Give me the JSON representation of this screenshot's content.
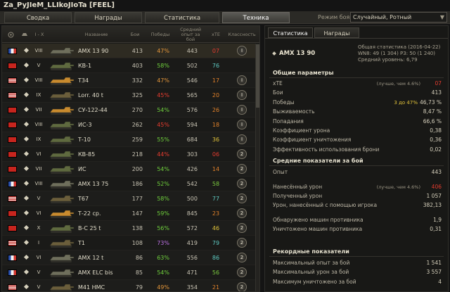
{
  "window": {
    "title": "Za_PyJIeM_LLIkoJIoTa [FEEL]"
  },
  "tabs": [
    {
      "label": "Сводка",
      "active": false
    },
    {
      "label": "Награды",
      "active": false
    },
    {
      "label": "Статистика",
      "active": false
    },
    {
      "label": "Техника",
      "active": true
    }
  ],
  "mode": {
    "label": "Режим боя:",
    "value": "Случайный, Ротный"
  },
  "table_header": {
    "type": "I - X",
    "name": "Название",
    "battles": "Бои",
    "wins": "Победы",
    "avg_xp": "Средний опыт за бой",
    "xte": "хТЕ",
    "mastery": "Классность"
  },
  "colors": {
    "wr_purple": "#b96fe0",
    "wr_green": "#6fcf3c",
    "wr_orange": "#e2953a",
    "wr_red": "#e33b2e",
    "xte_red": "#e33b2e",
    "xte_orange": "#e0812a",
    "xte_yellow": "#e0c23a",
    "xte_green": "#7ac83e",
    "xte_teal": "#5ec8c0",
    "xte_purple": "#b96fe0"
  },
  "vehicles": [
    {
      "flag": "fr",
      "tier": "VIII",
      "tank_icon": "tank-icon",
      "name": "AMX 13 90",
      "battles": "413",
      "wr": "47%",
      "wr_color": "#e2953a",
      "avg_xp": "443",
      "xte": "07",
      "xte_color": "#e33b2e",
      "mastery": "I",
      "highlight": true
    },
    {
      "flag": "ussr",
      "tier": "V",
      "tank_icon": "tank-icon",
      "name": "КВ-1",
      "battles": "403",
      "wr": "58%",
      "wr_color": "#6fcf3c",
      "avg_xp": "502",
      "xte": "76",
      "xte_color": "#5ec8c0",
      "mastery": "",
      "highlight": false
    },
    {
      "flag": "us",
      "tier": "VIII",
      "tank_icon": "tank-icon",
      "name": "T34",
      "battles": "332",
      "wr": "47%",
      "wr_color": "#e2953a",
      "avg_xp": "546",
      "xte": "17",
      "xte_color": "#e0812a",
      "mastery": "I",
      "highlight": false
    },
    {
      "flag": "us",
      "tier": "IX",
      "tank_icon": "tank-icon",
      "name": "Lorr. 40 t",
      "battles": "325",
      "wr": "45%",
      "wr_color": "#e33b2e",
      "avg_xp": "565",
      "xte": "20",
      "xte_color": "#e0812a",
      "mastery": "I",
      "highlight": false
    },
    {
      "flag": "ussr",
      "tier": "VII",
      "tank_icon": "tank-icon",
      "name": "СУ-122-44",
      "battles": "270",
      "wr": "54%",
      "wr_color": "#6fcf3c",
      "avg_xp": "576",
      "xte": "26",
      "xte_color": "#e0812a",
      "mastery": "I",
      "highlight": false
    },
    {
      "flag": "ussr",
      "tier": "VIII",
      "tank_icon": "tank-icon",
      "name": "ИС-3",
      "battles": "262",
      "wr": "45%",
      "wr_color": "#e33b2e",
      "avg_xp": "594",
      "xte": "18",
      "xte_color": "#e0812a",
      "mastery": "I",
      "highlight": false
    },
    {
      "flag": "ussr",
      "tier": "IX",
      "tank_icon": "tank-icon",
      "name": "Т-10",
      "battles": "259",
      "wr": "55%",
      "wr_color": "#6fcf3c",
      "avg_xp": "684",
      "xte": "36",
      "xte_color": "#e0c23a",
      "mastery": "I",
      "highlight": false
    },
    {
      "flag": "ussr",
      "tier": "VI",
      "tank_icon": "tank-icon",
      "name": "КВ-85",
      "battles": "218",
      "wr": "44%",
      "wr_color": "#e33b2e",
      "avg_xp": "303",
      "xte": "06",
      "xte_color": "#e33b2e",
      "mastery": "2",
      "highlight": false
    },
    {
      "flag": "ussr",
      "tier": "VII",
      "tank_icon": "tank-icon",
      "name": "ИС",
      "battles": "200",
      "wr": "54%",
      "wr_color": "#6fcf3c",
      "avg_xp": "426",
      "xte": "14",
      "xte_color": "#e0812a",
      "mastery": "2",
      "highlight": false
    },
    {
      "flag": "fr",
      "tier": "VIII",
      "tank_icon": "tank-icon",
      "name": "AMX 13 75",
      "battles": "186",
      "wr": "52%",
      "wr_color": "#6fcf3c",
      "avg_xp": "542",
      "xte": "58",
      "xte_color": "#7ac83e",
      "mastery": "2",
      "highlight": false
    },
    {
      "flag": "us",
      "tier": "V",
      "tank_icon": "tank-icon",
      "name": "T67",
      "battles": "177",
      "wr": "58%",
      "wr_color": "#6fcf3c",
      "avg_xp": "500",
      "xte": "77",
      "xte_color": "#5ec8c0",
      "mastery": "2",
      "highlight": false
    },
    {
      "flag": "ussr",
      "tier": "VI",
      "tank_icon": "tank-icon",
      "name": "Т-22 ср.",
      "battles": "147",
      "wr": "59%",
      "wr_color": "#6fcf3c",
      "avg_xp": "845",
      "xte": "23",
      "xte_color": "#e0812a",
      "mastery": "2",
      "highlight": false
    },
    {
      "flag": "ussr",
      "tier": "X",
      "tank_icon": "tank-icon",
      "name": "B-C 25 t",
      "battles": "138",
      "wr": "56%",
      "wr_color": "#6fcf3c",
      "avg_xp": "572",
      "xte": "46",
      "xte_color": "#e0c23a",
      "mastery": "2",
      "highlight": false
    },
    {
      "flag": "us",
      "tier": "I",
      "tank_icon": "tank-icon",
      "name": "T1",
      "battles": "108",
      "wr": "73%",
      "wr_color": "#b96fe0",
      "avg_xp": "419",
      "xte": "79",
      "xte_color": "#5ec8c0",
      "mastery": "2",
      "highlight": false
    },
    {
      "flag": "fr",
      "tier": "VI",
      "tank_icon": "tank-icon",
      "name": "AMX 12 t",
      "battles": "86",
      "wr": "63%",
      "wr_color": "#6fcf3c",
      "avg_xp": "556",
      "xte": "86",
      "xte_color": "#5ec8c0",
      "mastery": "2",
      "highlight": false
    },
    {
      "flag": "fr",
      "tier": "V",
      "tank_icon": "tank-icon",
      "name": "AMX ELC bis",
      "battles": "85",
      "wr": "54%",
      "wr_color": "#6fcf3c",
      "avg_xp": "471",
      "xte": "56",
      "xte_color": "#7ac83e",
      "mastery": "2",
      "highlight": false
    },
    {
      "flag": "us",
      "tier": "V",
      "tank_icon": "tank-icon",
      "name": "M41 HMC",
      "battles": "79",
      "wr": "49%",
      "wr_color": "#e2953a",
      "avg_xp": "354",
      "xte": "21",
      "xte_color": "#e0812a",
      "mastery": "2",
      "highlight": false
    }
  ],
  "detail_tabs": [
    {
      "label": "Статистика",
      "active": true
    },
    {
      "label": "Награды",
      "active": false
    }
  ],
  "detail": {
    "vehicle": "AMX 13 90",
    "info_line1": "Общая статистика (2016-04-22)",
    "info_line2": "WN8: 49 (1 304) РЗ: 50 (1 240)",
    "info_line3": "Средний уровень: 6,79",
    "general_title": "Общие параметры",
    "general": [
      {
        "label": "хТЕ",
        "note": "(лучше, чем 4.6%)",
        "value": "07",
        "value_color": "#e33b2e"
      },
      {
        "label": "Бои",
        "note": "",
        "value": "413",
        "value_color": "#d6d0bc"
      },
      {
        "label": "Победы",
        "note": "3 до 47%",
        "value": "46,73 %",
        "value_color": "#d6d0bc"
      },
      {
        "label": "Выживаемость",
        "note": "",
        "value": "8,47 %",
        "value_color": "#d6d0bc"
      },
      {
        "label": "Попадания",
        "note": "",
        "value": "66,6 %",
        "value_color": "#d6d0bc"
      },
      {
        "label": "Коэффициент урона",
        "note": "",
        "value": "0,38",
        "value_color": "#d6d0bc"
      },
      {
        "label": "Коэффициент уничтожения",
        "note": "",
        "value": "0,36",
        "value_color": "#d6d0bc"
      },
      {
        "label": "Эффективность использования брони",
        "note": "",
        "value": "0,02",
        "value_color": "#d6d0bc"
      }
    ],
    "avg_title": "Средние показатели за бой",
    "avg": [
      {
        "label": "Опыт",
        "note": "",
        "value": "443",
        "value_color": "#d6d0bc"
      },
      {
        "label": "Нанесённый урон",
        "note": "(лучше, чем 4.6%)",
        "value": "406",
        "value_color": "#e33b2e"
      },
      {
        "label": "Полученный урон",
        "note": "",
        "value": "1 057",
        "value_color": "#d6d0bc"
      },
      {
        "label": "Урон, нанесённый с помощью игрока",
        "note": "",
        "value": "382,13",
        "value_color": "#d6d0bc"
      },
      {
        "label": "Обнаружено машин противника",
        "note": "",
        "value": "1,9",
        "value_color": "#d6d0bc"
      },
      {
        "label": "Уничтожено машин противника",
        "note": "",
        "value": "0,31",
        "value_color": "#d6d0bc"
      }
    ],
    "records_title": "Рекордные показатели",
    "records": [
      {
        "label": "Максимальный опыт за бой",
        "value": "1 541"
      },
      {
        "label": "Максимальный урон за бой",
        "value": "3 557"
      },
      {
        "label": "Максимум уничтожено за бой",
        "value": "4"
      }
    ]
  }
}
